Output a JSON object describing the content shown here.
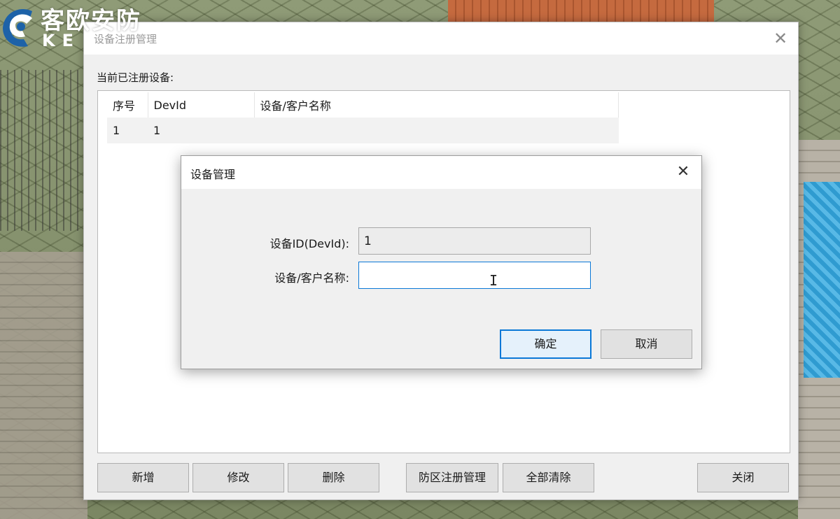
{
  "watermark": {
    "brand_cn": "客欧安防",
    "brand_en": "KE"
  },
  "main_window": {
    "title": "设备注册管理",
    "close_icon": "close-icon",
    "list_label": "当前已注册设备:",
    "table": {
      "headers": [
        "序号",
        "DevId",
        "设备/客户名称"
      ],
      "rows": [
        [
          "1",
          "1",
          ""
        ]
      ]
    },
    "buttons": {
      "add": "新增",
      "edit": "修改",
      "delete": "删除",
      "zone_manage": "防区注册管理",
      "clear_all": "全部清除",
      "close": "关闭"
    }
  },
  "dialog": {
    "title": "设备管理",
    "close_icon": "close-icon",
    "devid_label": "设备ID(DevId):",
    "devid_value": "1",
    "name_label": "设备/客户名称:",
    "name_value": "",
    "ok": "确定",
    "cancel": "取消"
  }
}
